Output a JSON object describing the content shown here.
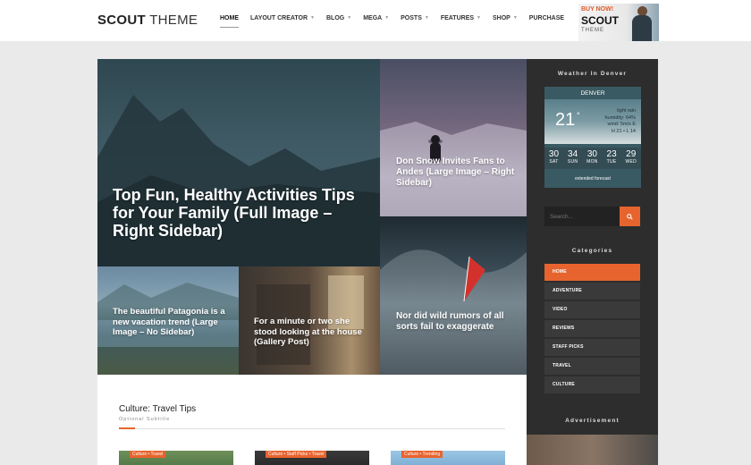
{
  "header": {
    "logo_bold": "SCOUT",
    "logo_light": " THEME",
    "nav": [
      {
        "label": "HOME",
        "caret": false
      },
      {
        "label": "LAYOUT CREATOR",
        "caret": true
      },
      {
        "label": "BLOG",
        "caret": true
      },
      {
        "label": "MEGA",
        "caret": true
      },
      {
        "label": "POSTS",
        "caret": true
      },
      {
        "label": "FEATURES",
        "caret": true
      },
      {
        "label": "SHOP",
        "caret": true
      },
      {
        "label": "PURCHASE",
        "caret": false
      }
    ],
    "ad": {
      "buy": "BUY NOW!",
      "brand": "SCOUT",
      "theme": "THEME"
    }
  },
  "hero": {
    "main": "Top Fun, Healthy Activities Tips for Your Family (Full Image – Right Sidebar)",
    "snow": "Don Snow Invites Fans to Andes (Large Image – Right Sidebar)",
    "wave": "Nor did wild rumors of all sorts fail to exaggerate",
    "patagonia": "The beautiful Patagonia is a new vacation trend (Large Image – No Sidebar)",
    "room": "For a minute or two she stood looking at the house (Gallery Post)"
  },
  "section": {
    "title": "Culture: Travel Tips",
    "subtitle": "Optional Subtitle",
    "cards": [
      {
        "tag": "Culture • Travel"
      },
      {
        "tag": "Culture • Staff Picks • Travel"
      },
      {
        "tag": "Culture • Trending"
      }
    ]
  },
  "sidebar": {
    "weather_title": "Weather In Denver",
    "weather": {
      "city": "DENVER",
      "temp": "21",
      "degree": "°",
      "condition": "light rain",
      "humidity": "humidity: 64%",
      "wind": "wind: 5m/s E",
      "hl": "H 21 • L 14",
      "days": [
        {
          "temp": "30",
          "day": "SAT"
        },
        {
          "temp": "34",
          "day": "SUN"
        },
        {
          "temp": "30",
          "day": "MON"
        },
        {
          "temp": "23",
          "day": "TUE"
        },
        {
          "temp": "29",
          "day": "WED"
        }
      ],
      "extended": "extended forecast"
    },
    "search_placeholder": "Search...",
    "categories_title": "Categories",
    "categories": [
      "HOME",
      "ADVENTURE",
      "VIDEO",
      "REVIEWS",
      "STAFF PICKS",
      "TRAVEL",
      "CULTURE"
    ],
    "advertisement_title": "Advertisement"
  },
  "colors": {
    "accent": "#e8642e",
    "sidebar": "#2d2d2d"
  }
}
